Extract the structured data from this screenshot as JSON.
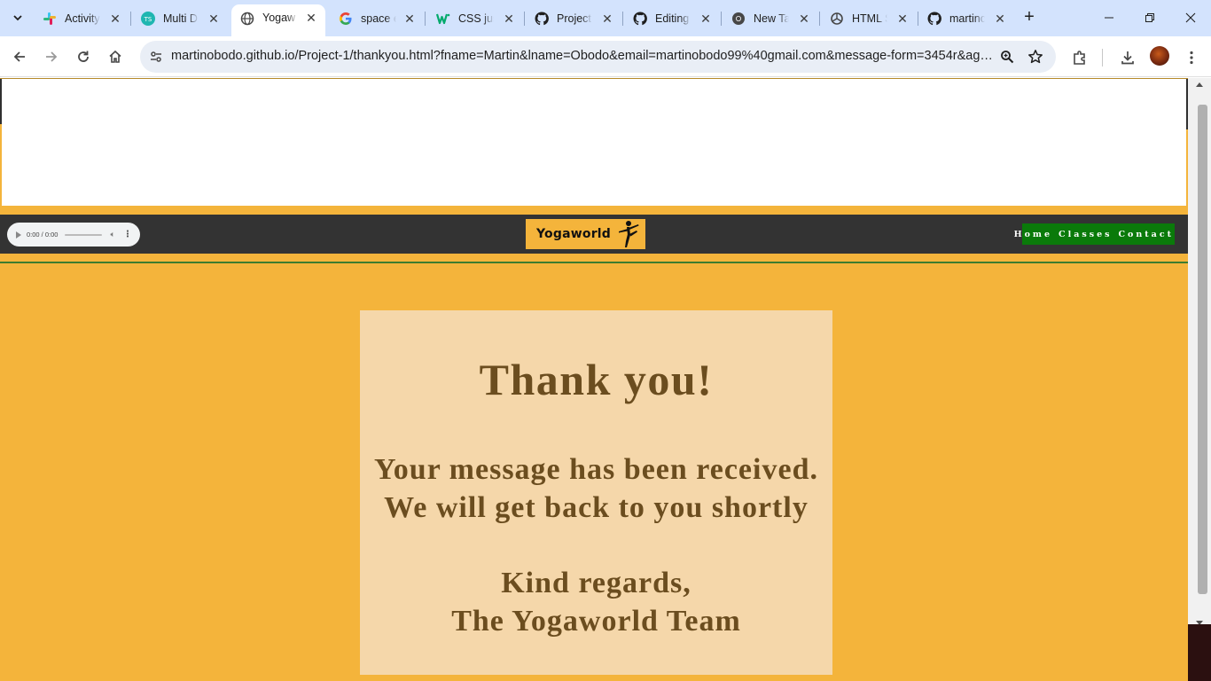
{
  "browser": {
    "tabs": [
      {
        "title": "Activity",
        "icon": "slack-icon",
        "active": false
      },
      {
        "title": "Multi D",
        "icon": "ts-icon",
        "active": false
      },
      {
        "title": "Yogaw",
        "icon": "globe-icon",
        "active": true
      },
      {
        "title": "space e",
        "icon": "google-icon",
        "active": false
      },
      {
        "title": "CSS jus",
        "icon": "w3-icon",
        "active": false
      },
      {
        "title": "Project",
        "icon": "github-icon",
        "active": false
      },
      {
        "title": "Editing",
        "icon": "github-icon",
        "active": false
      },
      {
        "title": "New Ta",
        "icon": "chrome-icon",
        "active": false
      },
      {
        "title": "HTML S",
        "icon": "openai-icon",
        "active": false
      },
      {
        "title": "martinc",
        "icon": "github-icon",
        "active": false
      }
    ],
    "url": "martinobodo.github.io/Project-1/thankyou.html?fname=Martin&lname=Obodo&email=martinobodo99%40gmail.com&message-form=3454r&agre..."
  },
  "site": {
    "audio_time": "0:00 / 0:00",
    "logo_text": "Yogaworld",
    "nav": [
      "Home",
      "Classes",
      "Contact"
    ],
    "accent_colors": {
      "page": "#f4b43b",
      "navbar": "#333333",
      "menu": "#0a7a0a",
      "card": "#f5d7aa",
      "text": "#6b4d1f"
    }
  },
  "thankyou": {
    "title": "Thank you!",
    "message_line1": "Your message has been received.",
    "message_line2": "We will get back to you shortly",
    "regards_line1": "Kind regards,",
    "regards_line2": "The Yogaworld Team"
  }
}
